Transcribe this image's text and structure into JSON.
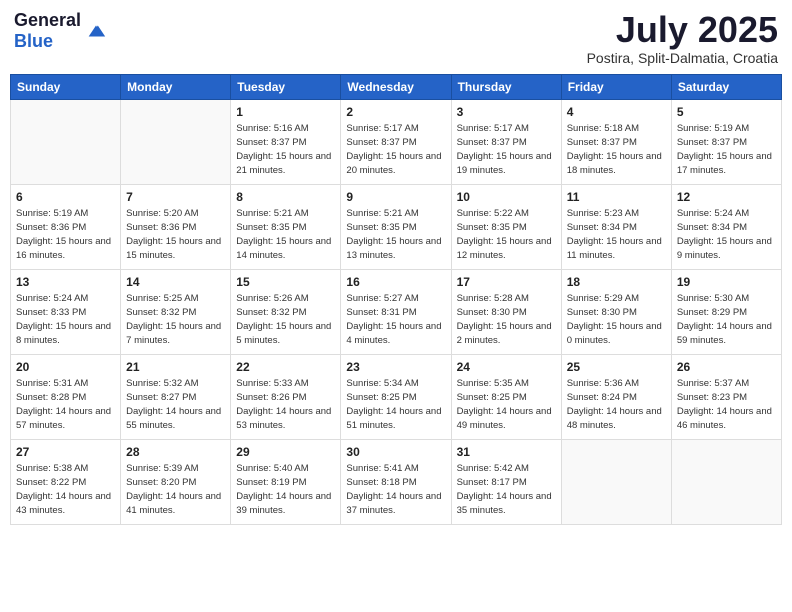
{
  "logo": {
    "general": "General",
    "blue": "Blue"
  },
  "header": {
    "month": "July 2025",
    "location": "Postira, Split-Dalmatia, Croatia"
  },
  "days_of_week": [
    "Sunday",
    "Monday",
    "Tuesday",
    "Wednesday",
    "Thursday",
    "Friday",
    "Saturday"
  ],
  "weeks": [
    [
      {
        "day": "",
        "sunrise": "",
        "sunset": "",
        "daylight": "",
        "empty": true
      },
      {
        "day": "",
        "sunrise": "",
        "sunset": "",
        "daylight": "",
        "empty": true
      },
      {
        "day": "1",
        "sunrise": "Sunrise: 5:16 AM",
        "sunset": "Sunset: 8:37 PM",
        "daylight": "Daylight: 15 hours and 21 minutes."
      },
      {
        "day": "2",
        "sunrise": "Sunrise: 5:17 AM",
        "sunset": "Sunset: 8:37 PM",
        "daylight": "Daylight: 15 hours and 20 minutes."
      },
      {
        "day": "3",
        "sunrise": "Sunrise: 5:17 AM",
        "sunset": "Sunset: 8:37 PM",
        "daylight": "Daylight: 15 hours and 19 minutes."
      },
      {
        "day": "4",
        "sunrise": "Sunrise: 5:18 AM",
        "sunset": "Sunset: 8:37 PM",
        "daylight": "Daylight: 15 hours and 18 minutes."
      },
      {
        "day": "5",
        "sunrise": "Sunrise: 5:19 AM",
        "sunset": "Sunset: 8:37 PM",
        "daylight": "Daylight: 15 hours and 17 minutes."
      }
    ],
    [
      {
        "day": "6",
        "sunrise": "Sunrise: 5:19 AM",
        "sunset": "Sunset: 8:36 PM",
        "daylight": "Daylight: 15 hours and 16 minutes."
      },
      {
        "day": "7",
        "sunrise": "Sunrise: 5:20 AM",
        "sunset": "Sunset: 8:36 PM",
        "daylight": "Daylight: 15 hours and 15 minutes."
      },
      {
        "day": "8",
        "sunrise": "Sunrise: 5:21 AM",
        "sunset": "Sunset: 8:35 PM",
        "daylight": "Daylight: 15 hours and 14 minutes."
      },
      {
        "day": "9",
        "sunrise": "Sunrise: 5:21 AM",
        "sunset": "Sunset: 8:35 PM",
        "daylight": "Daylight: 15 hours and 13 minutes."
      },
      {
        "day": "10",
        "sunrise": "Sunrise: 5:22 AM",
        "sunset": "Sunset: 8:35 PM",
        "daylight": "Daylight: 15 hours and 12 minutes."
      },
      {
        "day": "11",
        "sunrise": "Sunrise: 5:23 AM",
        "sunset": "Sunset: 8:34 PM",
        "daylight": "Daylight: 15 hours and 11 minutes."
      },
      {
        "day": "12",
        "sunrise": "Sunrise: 5:24 AM",
        "sunset": "Sunset: 8:34 PM",
        "daylight": "Daylight: 15 hours and 9 minutes."
      }
    ],
    [
      {
        "day": "13",
        "sunrise": "Sunrise: 5:24 AM",
        "sunset": "Sunset: 8:33 PM",
        "daylight": "Daylight: 15 hours and 8 minutes."
      },
      {
        "day": "14",
        "sunrise": "Sunrise: 5:25 AM",
        "sunset": "Sunset: 8:32 PM",
        "daylight": "Daylight: 15 hours and 7 minutes."
      },
      {
        "day": "15",
        "sunrise": "Sunrise: 5:26 AM",
        "sunset": "Sunset: 8:32 PM",
        "daylight": "Daylight: 15 hours and 5 minutes."
      },
      {
        "day": "16",
        "sunrise": "Sunrise: 5:27 AM",
        "sunset": "Sunset: 8:31 PM",
        "daylight": "Daylight: 15 hours and 4 minutes."
      },
      {
        "day": "17",
        "sunrise": "Sunrise: 5:28 AM",
        "sunset": "Sunset: 8:30 PM",
        "daylight": "Daylight: 15 hours and 2 minutes."
      },
      {
        "day": "18",
        "sunrise": "Sunrise: 5:29 AM",
        "sunset": "Sunset: 8:30 PM",
        "daylight": "Daylight: 15 hours and 0 minutes."
      },
      {
        "day": "19",
        "sunrise": "Sunrise: 5:30 AM",
        "sunset": "Sunset: 8:29 PM",
        "daylight": "Daylight: 14 hours and 59 minutes."
      }
    ],
    [
      {
        "day": "20",
        "sunrise": "Sunrise: 5:31 AM",
        "sunset": "Sunset: 8:28 PM",
        "daylight": "Daylight: 14 hours and 57 minutes."
      },
      {
        "day": "21",
        "sunrise": "Sunrise: 5:32 AM",
        "sunset": "Sunset: 8:27 PM",
        "daylight": "Daylight: 14 hours and 55 minutes."
      },
      {
        "day": "22",
        "sunrise": "Sunrise: 5:33 AM",
        "sunset": "Sunset: 8:26 PM",
        "daylight": "Daylight: 14 hours and 53 minutes."
      },
      {
        "day": "23",
        "sunrise": "Sunrise: 5:34 AM",
        "sunset": "Sunset: 8:25 PM",
        "daylight": "Daylight: 14 hours and 51 minutes."
      },
      {
        "day": "24",
        "sunrise": "Sunrise: 5:35 AM",
        "sunset": "Sunset: 8:25 PM",
        "daylight": "Daylight: 14 hours and 49 minutes."
      },
      {
        "day": "25",
        "sunrise": "Sunrise: 5:36 AM",
        "sunset": "Sunset: 8:24 PM",
        "daylight": "Daylight: 14 hours and 48 minutes."
      },
      {
        "day": "26",
        "sunrise": "Sunrise: 5:37 AM",
        "sunset": "Sunset: 8:23 PM",
        "daylight": "Daylight: 14 hours and 46 minutes."
      }
    ],
    [
      {
        "day": "27",
        "sunrise": "Sunrise: 5:38 AM",
        "sunset": "Sunset: 8:22 PM",
        "daylight": "Daylight: 14 hours and 43 minutes."
      },
      {
        "day": "28",
        "sunrise": "Sunrise: 5:39 AM",
        "sunset": "Sunset: 8:20 PM",
        "daylight": "Daylight: 14 hours and 41 minutes."
      },
      {
        "day": "29",
        "sunrise": "Sunrise: 5:40 AM",
        "sunset": "Sunset: 8:19 PM",
        "daylight": "Daylight: 14 hours and 39 minutes."
      },
      {
        "day": "30",
        "sunrise": "Sunrise: 5:41 AM",
        "sunset": "Sunset: 8:18 PM",
        "daylight": "Daylight: 14 hours and 37 minutes."
      },
      {
        "day": "31",
        "sunrise": "Sunrise: 5:42 AM",
        "sunset": "Sunset: 8:17 PM",
        "daylight": "Daylight: 14 hours and 35 minutes."
      },
      {
        "day": "",
        "sunrise": "",
        "sunset": "",
        "daylight": "",
        "empty": true
      },
      {
        "day": "",
        "sunrise": "",
        "sunset": "",
        "daylight": "",
        "empty": true
      }
    ]
  ]
}
